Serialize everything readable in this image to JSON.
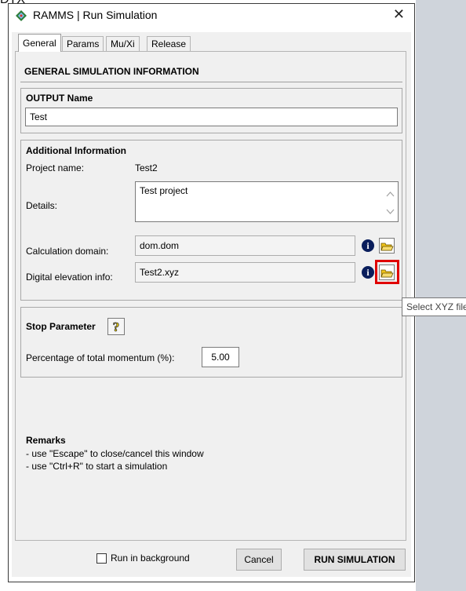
{
  "crop_text": "DTX",
  "window": {
    "title": "RAMMS | Run Simulation",
    "close_glyph": "✕"
  },
  "tabs": [
    {
      "label": "General",
      "active": true
    },
    {
      "label": "Params",
      "active": false
    },
    {
      "label": "Mu/Xi",
      "active": false
    },
    {
      "label": "Release",
      "active": false
    }
  ],
  "general": {
    "heading": "GENERAL SIMULATION INFORMATION",
    "output": {
      "title": "OUTPUT Name",
      "value": "Test"
    },
    "additional": {
      "title": "Additional Information",
      "project_label": "Project name:",
      "project_value": "Test2",
      "details_label": "Details:",
      "details_value": "Test project",
      "domain_label": "Calculation domain:",
      "domain_value": "dom.dom",
      "dem_label": "Digital elevation info:",
      "dem_value": "Test2.xyz"
    },
    "stop": {
      "title": "Stop Parameter",
      "momentum_label": "Percentage of total momentum (%):",
      "momentum_value": "5.00"
    },
    "remarks": {
      "title": "Remarks",
      "lines": [
        "- use \"Escape\" to close/cancel this window",
        "- use \"Ctrl+R\" to start a simulation"
      ]
    }
  },
  "tooltip": "Select XYZ file",
  "footer": {
    "background_label": "Run in background",
    "background_checked": false,
    "cancel_label": "Cancel",
    "run_label": "RUN SIMULATION"
  },
  "colors": {
    "highlight": "#e00000",
    "info_icon": "#0a1e5c",
    "folder": "#f0c419"
  }
}
